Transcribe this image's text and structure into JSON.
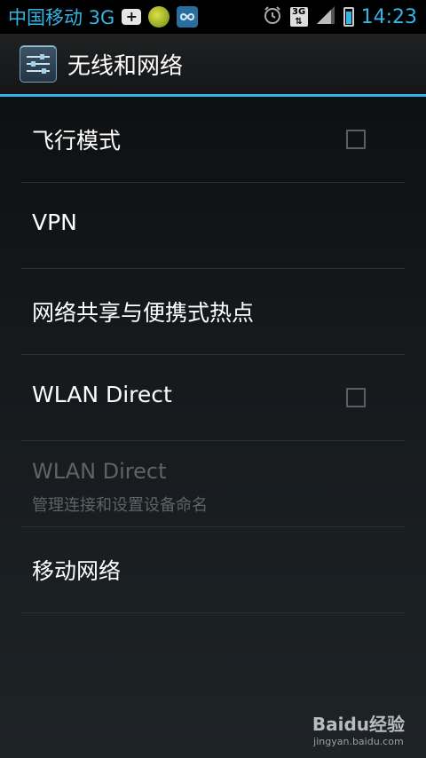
{
  "status_bar": {
    "carrier": "中国移动 3G",
    "badge_3g": "3G",
    "time": "14:23",
    "icons": [
      "plus-notification-icon",
      "game-notification-icon",
      "loop-notification-icon",
      "alarm-icon",
      "3g-data-icon",
      "signal-icon",
      "battery-charging-icon"
    ]
  },
  "action_bar": {
    "title": "无线和网络",
    "icon": "settings-icon"
  },
  "settings": [
    {
      "title": "飞行模式",
      "has_checkbox": true,
      "checked": false
    },
    {
      "title": "VPN"
    },
    {
      "title": "网络共享与便携式热点"
    },
    {
      "title": "WLAN Direct",
      "has_checkbox": true,
      "checked": false
    },
    {
      "title": "WLAN Direct",
      "subtitle": "管理连接和设置设备命名",
      "disabled": true
    },
    {
      "title": "移动网络"
    }
  ],
  "watermark": {
    "logo": "Baidu经验",
    "url": "jingyan.baidu.com"
  },
  "colors": {
    "accent": "#33b5e5",
    "disabled_text": "#5d6366",
    "divider": "#2c3134"
  }
}
